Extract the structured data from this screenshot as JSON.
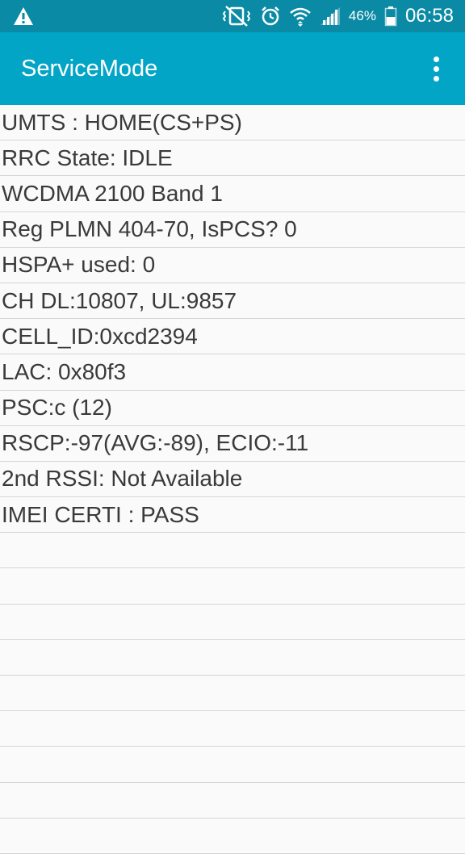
{
  "status_bar": {
    "battery_percent": "46%",
    "time": "06:58",
    "icons": [
      "warning-icon",
      "vibrate-mute-icon",
      "alarm-icon",
      "wifi-icon",
      "signal-icon",
      "battery-icon"
    ],
    "colors": {
      "background": "#0a8aa4",
      "foreground": "#ffffff"
    }
  },
  "app_bar": {
    "title": "ServiceMode",
    "menu_icon": "more-vert-icon",
    "color": "#03a5c6"
  },
  "lines": [
    "UMTS : HOME(CS+PS)",
    "RRC State: IDLE",
    "WCDMA 2100 Band 1",
    "Reg PLMN 404-70, IsPCS? 0",
    "HSPA+ used: 0",
    "CH DL:10807, UL:9857",
    "CELL_ID:0xcd2394",
    "LAC: 0x80f3",
    "PSC:c (12)",
    "RSCP:-97(AVG:-89), ECIO:-11",
    "2nd RSSI: Not Available",
    "IMEI CERTI : PASS",
    "",
    "",
    "",
    "",
    "",
    "",
    "",
    "",
    ""
  ]
}
